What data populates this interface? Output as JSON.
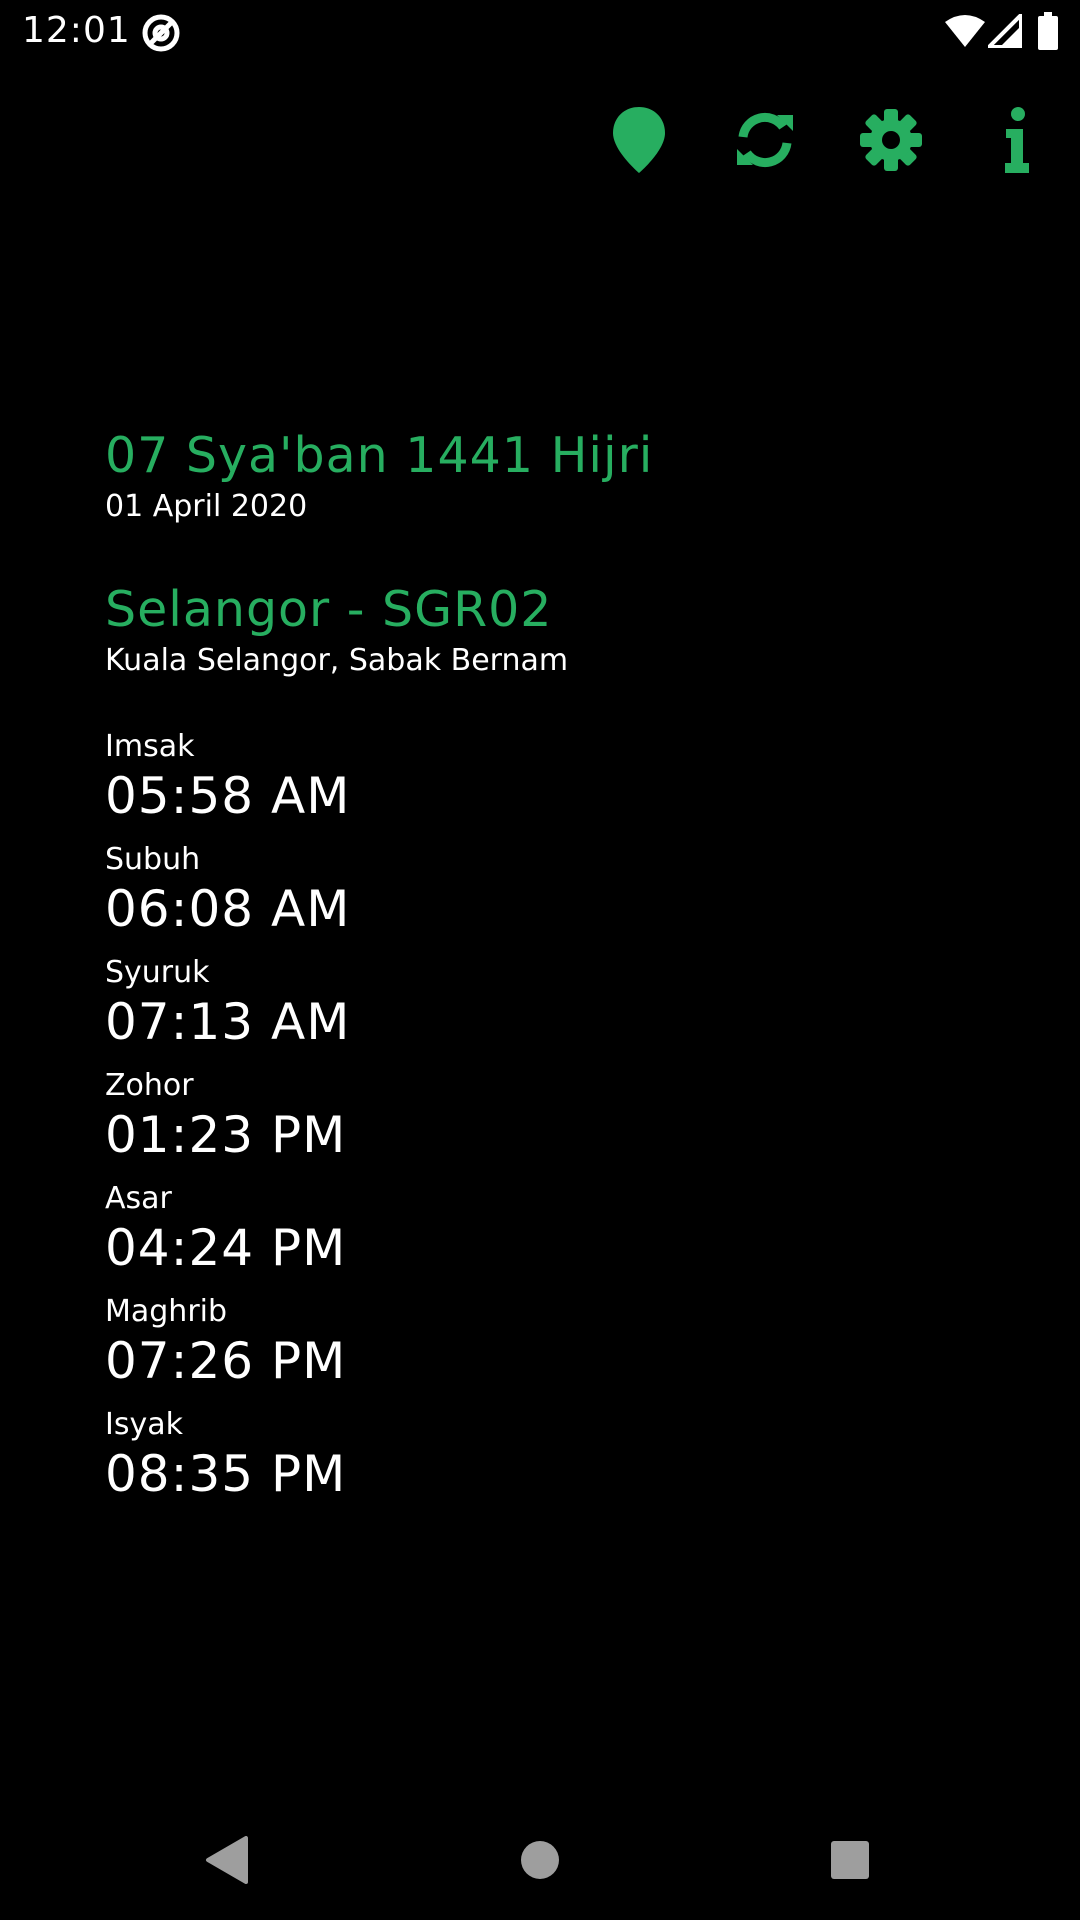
{
  "status_bar": {
    "time": "12:01",
    "icons": [
      "at-sign-icon",
      "wifi-icon",
      "signal-icon",
      "battery-icon"
    ]
  },
  "toolbar": {
    "icons": [
      "location-pin-icon",
      "refresh-icon",
      "settings-gear-icon",
      "info-icon"
    ]
  },
  "dates": {
    "hijri": "07 Sya'ban 1441 Hijri",
    "gregorian": "01 April 2020"
  },
  "zone": {
    "title": "Selangor - SGR02",
    "areas": "Kuala Selangor, Sabak Bernam"
  },
  "prayers": [
    {
      "name": "Imsak",
      "time": "05:58 AM"
    },
    {
      "name": "Subuh",
      "time": "06:08 AM"
    },
    {
      "name": "Syuruk",
      "time": "07:13 AM"
    },
    {
      "name": "Zohor",
      "time": "01:23 PM"
    },
    {
      "name": "Asar",
      "time": "04:24 PM"
    },
    {
      "name": "Maghrib",
      "time": "07:26 PM"
    },
    {
      "name": "Isyak",
      "time": "08:35 PM"
    }
  ],
  "nav_bar": {
    "icons": [
      "back-icon",
      "home-icon",
      "recents-icon"
    ]
  },
  "colors": {
    "accent": "#27ae60",
    "background": "#000000",
    "text": "#ffffff",
    "nav_icons": "#9e9e9e"
  }
}
